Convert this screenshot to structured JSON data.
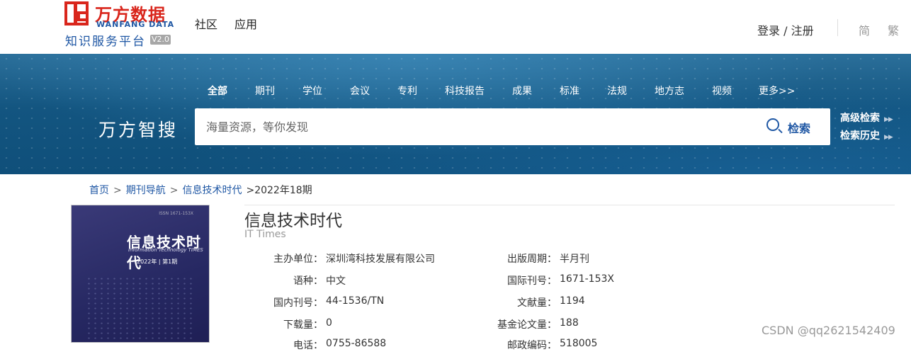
{
  "header": {
    "logo": {
      "cn": "万方数据",
      "en": "WANFANG DATA",
      "sub": "知识服务平台",
      "version": "V2.0"
    },
    "nav": [
      "社区",
      "应用"
    ],
    "login": "登录 / 注册",
    "lang": [
      "简",
      "繁"
    ]
  },
  "search": {
    "brand": "万方智搜",
    "tabs": [
      "全部",
      "期刊",
      "学位",
      "会议",
      "专利",
      "科技报告",
      "成果",
      "标准",
      "法规",
      "地方志",
      "视频",
      "更多>>"
    ],
    "placeholder": "海量资源，等你发现",
    "button": "检索",
    "advanced": "高级检索",
    "history": "检索历史"
  },
  "breadcrumb": {
    "home": "首页",
    "nav": "期刊导航",
    "journal": "信息技术时代",
    "issue": ">2022年18期"
  },
  "cover": {
    "title": "信息技术时代",
    "en": "Information Technology TIMES",
    "issue": "2022年 | 第1期",
    "top": "ISSN 1671-153X"
  },
  "journal": {
    "title": "信息技术时代",
    "en_title": "IT Times",
    "fields_left": [
      {
        "label": "主办单位：",
        "value": "深圳湾科技发展有限公司"
      },
      {
        "label": "语种：",
        "value": "中文"
      },
      {
        "label": "国内刊号：",
        "value": "44-1536/TN"
      },
      {
        "label": "下载量：",
        "value": "0"
      },
      {
        "label": "电话：",
        "value": "0755-86588"
      }
    ],
    "fields_right": [
      {
        "label": "出版周期：",
        "value": "半月刊"
      },
      {
        "label": "国际刊号：",
        "value": "1671-153X"
      },
      {
        "label": "文献量：",
        "value": "1194"
      },
      {
        "label": "基金论文量：",
        "value": "188"
      },
      {
        "label": "邮政编码：",
        "value": "518005"
      }
    ]
  },
  "watermark": "CSDN @qq2621542409",
  "colors": {
    "brand_red": "#d9261c",
    "brand_blue": "#1f57a4"
  }
}
